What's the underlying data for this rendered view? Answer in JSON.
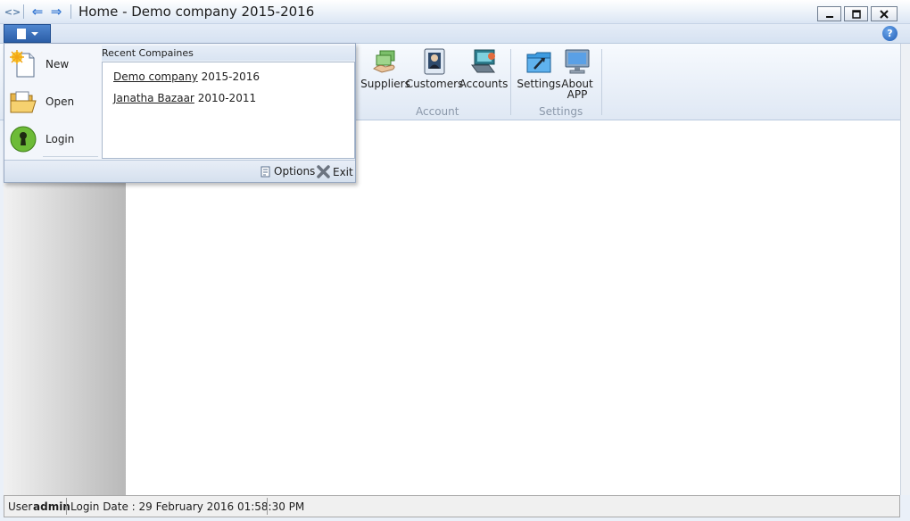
{
  "window": {
    "title": "Home - Demo company 2015-2016"
  },
  "ribbon": {
    "buttons": [
      {
        "label": "Suppliers",
        "icon": "suppliers-icon"
      },
      {
        "label": "Customers",
        "icon": "customers-icon"
      },
      {
        "label": "Accounts",
        "icon": "accounts-icon"
      },
      {
        "label": "Settings",
        "icon": "settings-icon"
      },
      {
        "label": "About APP",
        "icon": "about-icon"
      }
    ],
    "groups": [
      "Account",
      "Settings"
    ]
  },
  "app_menu": {
    "items": [
      {
        "label": "New",
        "icon": "new-document-icon"
      },
      {
        "label": "Open",
        "icon": "open-folder-icon"
      },
      {
        "label": "Login",
        "icon": "login-keyhole-icon"
      }
    ],
    "recent_header": "Recent Compaines",
    "recent": [
      {
        "name": "Demo company",
        "period": "2015-2016"
      },
      {
        "name": "Janatha Bazaar",
        "period": "2010-2011"
      }
    ],
    "options_label": "Options",
    "exit_label": "Exit"
  },
  "status": {
    "user_label": "User",
    "user": "admin",
    "login_text": "Login Date : 29 February 2016 01:58:30 PM"
  },
  "colors": {
    "accent": "#2c5fa8",
    "title_bg": "#dbe6f4",
    "ribbon_bg": "#dfe8f4"
  }
}
